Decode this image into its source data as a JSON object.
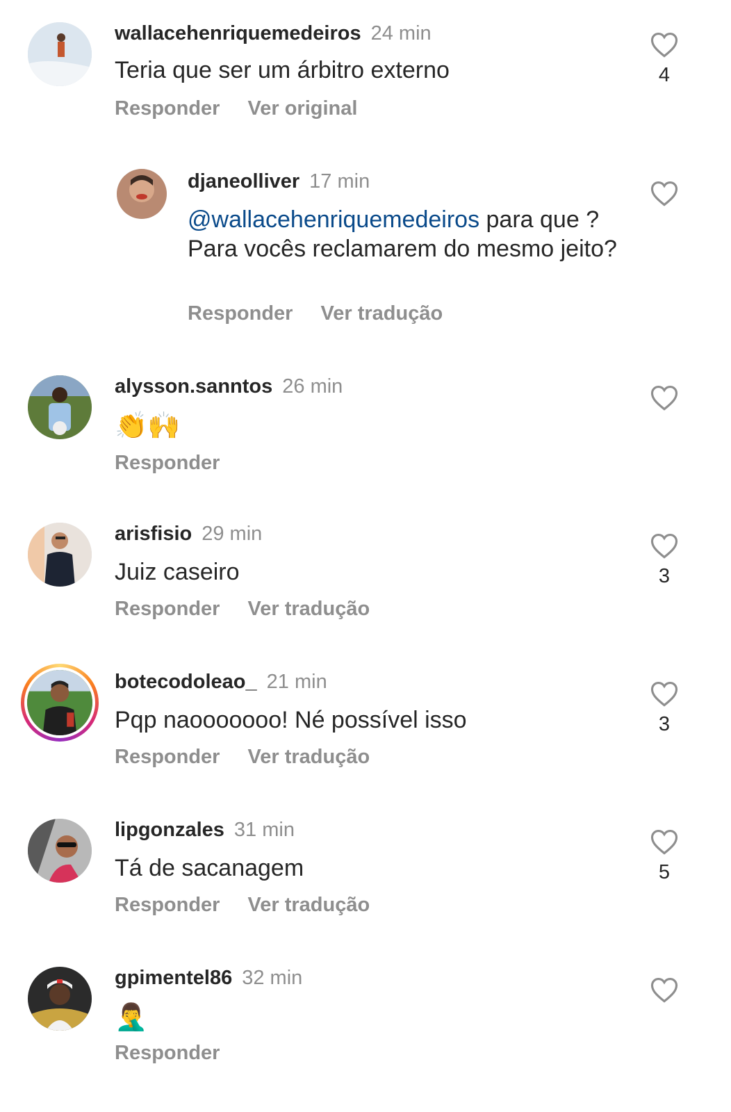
{
  "comments": [
    {
      "username": "wallacehenriquemedeiros",
      "time": "24 min",
      "text": "Teria que ser um árbitro externo",
      "reply_label": "Responder",
      "secondary_label": "Ver original",
      "likes": "4"
    },
    {
      "username": "djaneolliver",
      "time": "17 min",
      "mention": "@wallacehenriquemedeiros",
      "text": " para que ? Para vocês reclamarem do mesmo jeito?",
      "reply_label": "Responder",
      "secondary_label": "Ver tradução"
    },
    {
      "username": "alysson.sanntos",
      "time": "26 min",
      "text": "👏🙌",
      "reply_label": "Responder"
    },
    {
      "username": "arisfisio",
      "time": "29 min",
      "text": "Juiz caseiro",
      "reply_label": "Responder",
      "secondary_label": "Ver tradução",
      "likes": "3"
    },
    {
      "username": "botecodoleao_",
      "time": "21 min",
      "text": "Pqp naooooooo! Né possível isso",
      "reply_label": "Responder",
      "secondary_label": "Ver tradução",
      "likes": "3"
    },
    {
      "username": "lipgonzales",
      "time": "31 min",
      "text": "Tá de sacanagem",
      "reply_label": "Responder",
      "secondary_label": "Ver tradução",
      "likes": "5"
    },
    {
      "username": "gpimentel86",
      "time": "32 min",
      "text": "🤦‍♂️",
      "reply_label": "Responder"
    }
  ],
  "icons": {
    "like": "heart-outline-icon"
  },
  "colors": {
    "username": "#262626",
    "muted": "#8e8e8e",
    "mention": "#0a4a8a",
    "story_ring": "#d62976"
  }
}
